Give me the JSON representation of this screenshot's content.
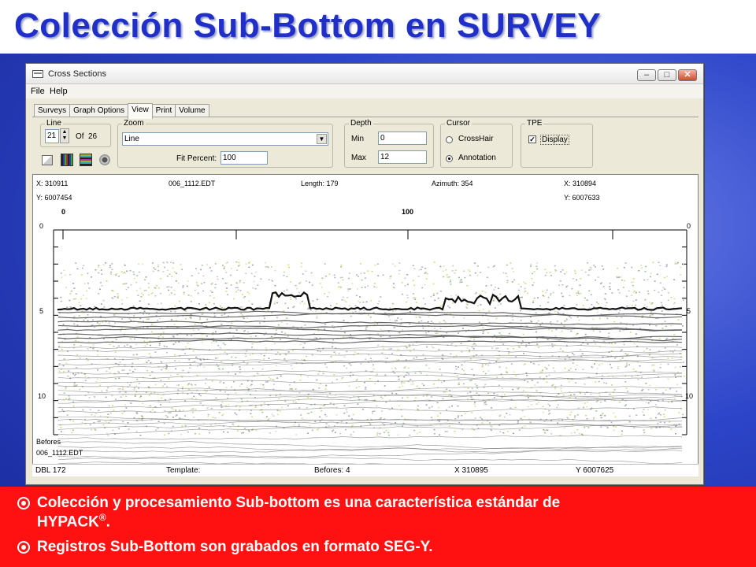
{
  "slide": {
    "title": "Colección Sub-Bottom en SURVEY",
    "bullets": [
      {
        "text": "Colección y procesamiento Sub-bottom es una característica estándar de",
        "cont": "HYPACK",
        "sup": "®",
        "end": "."
      },
      {
        "text": "Registros Sub-Bottom son grabados en formato SEG-Y."
      }
    ],
    "colors": {
      "title": "#1f2fc8",
      "bullet_box": "#ff1111",
      "background": "#2c44c8"
    }
  },
  "window": {
    "title": "Cross Sections",
    "controls": {
      "minimize": "–",
      "maximize": "□",
      "close": "✕"
    },
    "menu": [
      "File",
      "Help"
    ],
    "tabs": [
      "Surveys",
      "Graph Options",
      "View",
      "Print",
      "Volume"
    ],
    "active_tab": "View",
    "line_group": {
      "label": "Line",
      "value": "21",
      "of_label": "Of",
      "total": "26"
    },
    "zoom_group": {
      "label": "Zoom",
      "selected": "Line",
      "fit_label": "Fit Percent:",
      "fit_value": "100"
    },
    "depth_group": {
      "label": "Depth",
      "min_label": "Min",
      "min_value": "0",
      "max_label": "Max",
      "max_value": "12"
    },
    "cursor_group": {
      "label": "Cursor",
      "option1": "CrossHair",
      "option2": "Annotation",
      "selected": "Annotation"
    },
    "tpe_group": {
      "label": "TPE",
      "checkbox_label": "Display",
      "checked": true
    },
    "toolbar_icons": [
      "copy-icon",
      "color-palette-icon",
      "color-palette-2-icon",
      "settings-icon"
    ]
  },
  "plot": {
    "x_left": "X: 310911",
    "y_left": "Y: 6007454",
    "file": "006_1112.EDT",
    "length": "Length: 179",
    "azimuth": "Azimuth: 354",
    "x_right": "X: 310894",
    "y_right": "Y: 6007633",
    "top_scale": [
      "0",
      "100"
    ],
    "depth_ticks": [
      "0",
      "5",
      "10"
    ],
    "befores_label": "Befores",
    "befores_file": "006_1112.EDT"
  },
  "status": {
    "dbl": "DBL 172",
    "template": "Template:",
    "befores": "Befores: 4",
    "x": "X 310895",
    "y": "Y 6007625"
  }
}
